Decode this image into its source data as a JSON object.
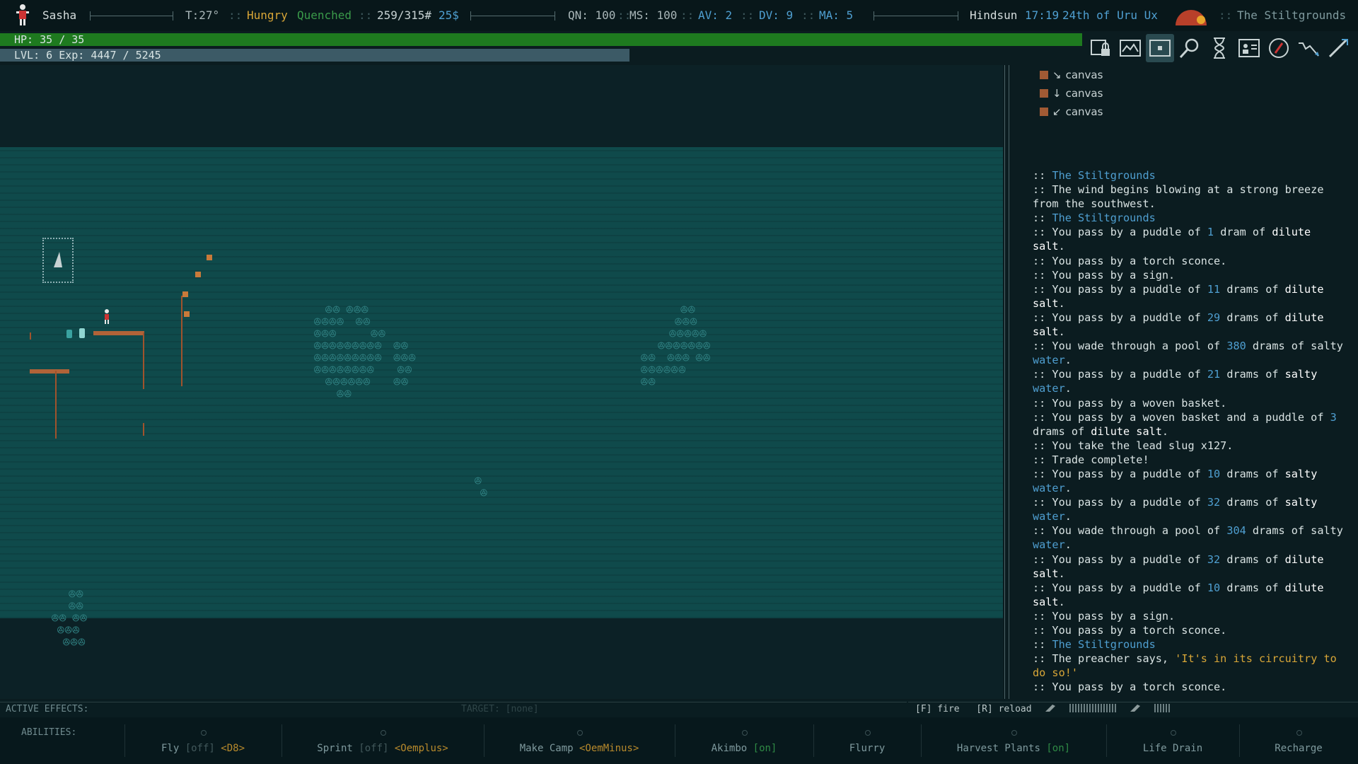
{
  "topbar": {
    "name": "Sasha",
    "temp": "T:27°",
    "hunger": "Hungry",
    "thirst": "Quenched",
    "weight": "259/315#",
    "money": "25$",
    "qn": "QN: 100",
    "ms": "MS: 100",
    "av": "AV: 2",
    "dv": "DV: 9",
    "ma": "MA: 5",
    "time_name": "Hindsun",
    "time": "17:19",
    "date": "24th of Uru Ux",
    "zone": "The Stiltgrounds",
    "sep": "::"
  },
  "hp": {
    "label": "HP: 35 / 35",
    "current": 35,
    "max": 35
  },
  "xp": {
    "label": "LVL: 6 Exp: 4447 / 5245",
    "level": 6,
    "current": 4447,
    "max": 5245
  },
  "toolbar": [
    "inventory-lock-icon",
    "world-map-icon",
    "local-map-icon",
    "look-icon",
    "wait-icon",
    "character-icon",
    "quests-icon",
    "autoexplore-icon",
    "attack-icon"
  ],
  "equipment": [
    {
      "arrow": "↘",
      "label": "canvas"
    },
    {
      "arrow": "↓",
      "label": "canvas"
    },
    {
      "arrow": "↙",
      "label": "canvas"
    }
  ],
  "log": [
    [
      {
        "t": ":: "
      },
      {
        "t": "The Stiltgrounds",
        "c": "hl"
      }
    ],
    [
      {
        "t": ":: The wind begins blowing at a strong breeze from the southwest."
      }
    ],
    [
      {
        "t": ":: "
      },
      {
        "t": "The Stiltgrounds",
        "c": "hl"
      }
    ],
    [
      {
        "t": ":: You pass by a puddle of "
      },
      {
        "t": "1",
        "c": "hl"
      },
      {
        "t": " dram of "
      },
      {
        "t": "dilute salt",
        "c": "wh"
      },
      {
        "t": "."
      }
    ],
    [
      {
        "t": ":: You pass by a torch sconce."
      }
    ],
    [
      {
        "t": ":: You pass by a sign."
      }
    ],
    [
      {
        "t": ":: You pass by a puddle of "
      },
      {
        "t": "11",
        "c": "hl"
      },
      {
        "t": " drams of "
      },
      {
        "t": "dilute salt",
        "c": "wh"
      },
      {
        "t": "."
      }
    ],
    [
      {
        "t": ":: You pass by a puddle of "
      },
      {
        "t": "29",
        "c": "hl"
      },
      {
        "t": " drams of "
      },
      {
        "t": "dilute salt",
        "c": "wh"
      },
      {
        "t": "."
      }
    ],
    [
      {
        "t": ":: You wade through a pool of "
      },
      {
        "t": "380",
        "c": "hl"
      },
      {
        "t": " drams of salty "
      },
      {
        "t": "water",
        "c": "hl"
      },
      {
        "t": "."
      }
    ],
    [
      {
        "t": ":: You pass by a puddle of "
      },
      {
        "t": "21",
        "c": "hl"
      },
      {
        "t": " drams of "
      },
      {
        "t": "salty",
        "c": "wh"
      },
      {
        "t": " "
      },
      {
        "t": "water",
        "c": "hl"
      },
      {
        "t": "."
      }
    ],
    [
      {
        "t": ":: You pass by a woven basket."
      }
    ],
    [
      {
        "t": ":: You pass by a woven basket and a puddle of "
      },
      {
        "t": "3",
        "c": "hl"
      },
      {
        "t": " drams of "
      },
      {
        "t": "dilute salt",
        "c": "wh"
      },
      {
        "t": "."
      }
    ],
    [
      {
        "t": ":: You take the lead slug x127."
      }
    ],
    [
      {
        "t": ":: Trade complete!"
      }
    ],
    [
      {
        "t": ":: You pass by a puddle of "
      },
      {
        "t": "10",
        "c": "hl"
      },
      {
        "t": " drams of "
      },
      {
        "t": "salty",
        "c": "wh"
      },
      {
        "t": " "
      },
      {
        "t": "water",
        "c": "hl"
      },
      {
        "t": "."
      }
    ],
    [
      {
        "t": ":: You pass by a puddle of "
      },
      {
        "t": "32",
        "c": "hl"
      },
      {
        "t": " drams of "
      },
      {
        "t": "salty",
        "c": "wh"
      },
      {
        "t": " "
      },
      {
        "t": "water",
        "c": "hl"
      },
      {
        "t": "."
      }
    ],
    [
      {
        "t": ":: You wade through a pool of "
      },
      {
        "t": "304",
        "c": "hl"
      },
      {
        "t": " drams of salty "
      },
      {
        "t": "water",
        "c": "hl"
      },
      {
        "t": "."
      }
    ],
    [
      {
        "t": ":: You pass by a puddle of "
      },
      {
        "t": "32",
        "c": "hl"
      },
      {
        "t": " drams of "
      },
      {
        "t": "dilute salt",
        "c": "wh"
      },
      {
        "t": "."
      }
    ],
    [
      {
        "t": ":: You pass by a puddle of "
      },
      {
        "t": "10",
        "c": "hl"
      },
      {
        "t": " drams of "
      },
      {
        "t": "dilute salt",
        "c": "wh"
      },
      {
        "t": "."
      }
    ],
    [
      {
        "t": ":: You pass by a sign."
      }
    ],
    [
      {
        "t": ":: You pass by a torch sconce."
      }
    ],
    [
      {
        "t": ":: "
      },
      {
        "t": "The Stiltgrounds",
        "c": "hl"
      }
    ],
    [
      {
        "t": ":: The preacher says, "
      },
      {
        "t": "'It's in its circuitry to do so!'",
        "c": "q"
      }
    ],
    [
      {
        "t": ":: You pass by a torch sconce."
      }
    ]
  ],
  "effects": {
    "active_label": "ACTIVE EFFECTS:",
    "target_label": "TARGET: [none]",
    "fire": "[F] fire",
    "reload": "[R] reload"
  },
  "abilities": {
    "label": "ABILITIES:",
    "items": [
      {
        "name": "Fly",
        "state": "[off]",
        "key": "<D8>"
      },
      {
        "name": "Sprint",
        "state": "[off]",
        "key": "<Oemplus>"
      },
      {
        "name": "Make Camp",
        "state": "",
        "key": "<OemMinus>"
      },
      {
        "name": "Akimbo",
        "state": "[on]",
        "key": ""
      },
      {
        "name": "Flurry",
        "state": "",
        "key": ""
      },
      {
        "name": "Harvest Plants",
        "state": "[on]",
        "key": ""
      },
      {
        "name": "Life Drain",
        "state": "",
        "key": ""
      },
      {
        "name": "Recharge",
        "state": "",
        "key": ""
      }
    ]
  },
  "colors": {
    "hp": "#1e7a1f",
    "xp": "#3c5a66",
    "water": "#0f4a4b",
    "highlight": "#4f9fd1",
    "quote": "#d8a637"
  }
}
